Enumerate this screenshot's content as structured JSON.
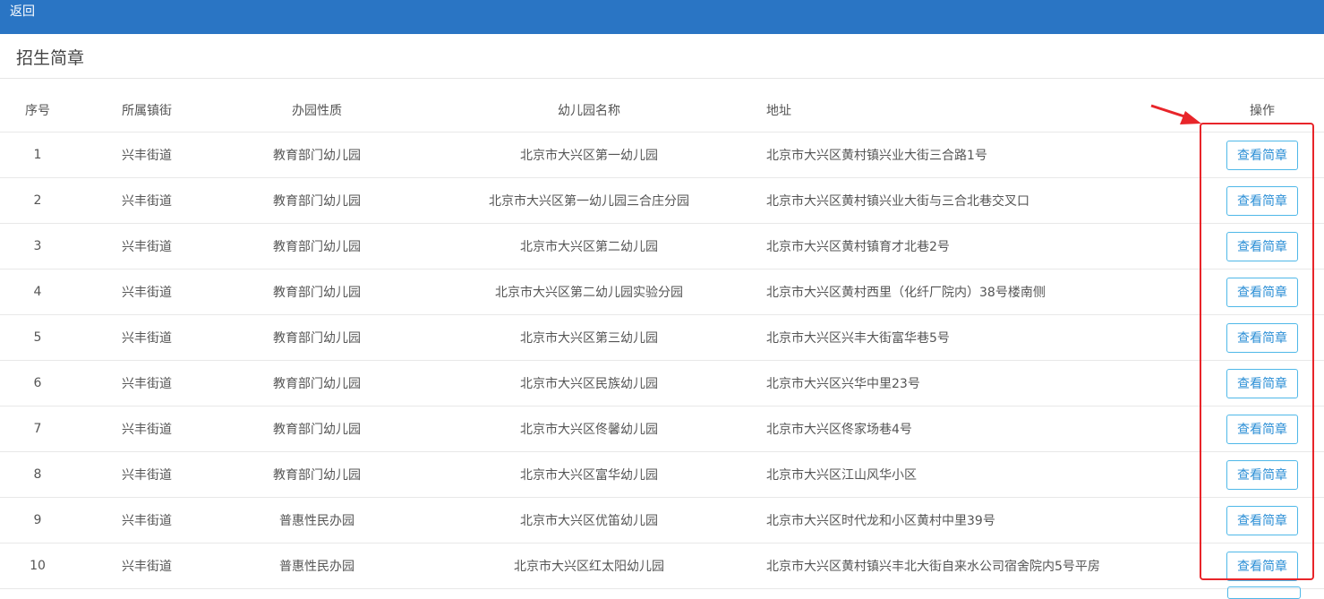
{
  "topbar": {
    "back_label": "返回"
  },
  "page": {
    "title": "招生简章"
  },
  "table": {
    "headers": {
      "seq": "序号",
      "street": "所属镇街",
      "type": "办园性质",
      "name": "幼儿园名称",
      "address": "地址",
      "operation": "操作"
    },
    "rows": [
      {
        "seq": "1",
        "street": "兴丰街道",
        "type": "教育部门幼儿园",
        "name": "北京市大兴区第一幼儿园",
        "address": "北京市大兴区黄村镇兴业大街三合路1号",
        "action": "查看简章"
      },
      {
        "seq": "2",
        "street": "兴丰街道",
        "type": "教育部门幼儿园",
        "name": "北京市大兴区第一幼儿园三合庄分园",
        "address": "北京市大兴区黄村镇兴业大街与三合北巷交叉口",
        "action": "查看简章"
      },
      {
        "seq": "3",
        "street": "兴丰街道",
        "type": "教育部门幼儿园",
        "name": "北京市大兴区第二幼儿园",
        "address": "北京市大兴区黄村镇育才北巷2号",
        "action": "查看简章"
      },
      {
        "seq": "4",
        "street": "兴丰街道",
        "type": "教育部门幼儿园",
        "name": "北京市大兴区第二幼儿园实验分园",
        "address": "北京市大兴区黄村西里（化纤厂院内）38号楼南侧",
        "action": "查看简章"
      },
      {
        "seq": "5",
        "street": "兴丰街道",
        "type": "教育部门幼儿园",
        "name": "北京市大兴区第三幼儿园",
        "address": "北京市大兴区兴丰大街富华巷5号",
        "action": "查看简章"
      },
      {
        "seq": "6",
        "street": "兴丰街道",
        "type": "教育部门幼儿园",
        "name": "北京市大兴区民族幼儿园",
        "address": "北京市大兴区兴华中里23号",
        "action": "查看简章"
      },
      {
        "seq": "7",
        "street": "兴丰街道",
        "type": "教育部门幼儿园",
        "name": "北京市大兴区佟馨幼儿园",
        "address": "北京市大兴区佟家场巷4号",
        "action": "查看简章"
      },
      {
        "seq": "8",
        "street": "兴丰街道",
        "type": "教育部门幼儿园",
        "name": "北京市大兴区富华幼儿园",
        "address": "北京市大兴区江山风华小区",
        "action": "查看简章"
      },
      {
        "seq": "9",
        "street": "兴丰街道",
        "type": "普惠性民办园",
        "name": "北京市大兴区优笛幼儿园",
        "address": "北京市大兴区时代龙和小区黄村中里39号",
        "action": "查看简章"
      },
      {
        "seq": "10",
        "street": "兴丰街道",
        "type": "普惠性民办园",
        "name": "北京市大兴区红太阳幼儿园",
        "address": "北京市大兴区黄村镇兴丰北大街自来水公司宿舍院内5号平房",
        "action": "查看简章"
      }
    ]
  },
  "annotation": {
    "color": "#e8252a"
  },
  "colors": {
    "topbar": "#2a75c4",
    "button_border": "#4fb8e8",
    "button_text": "#2c8fd6"
  }
}
